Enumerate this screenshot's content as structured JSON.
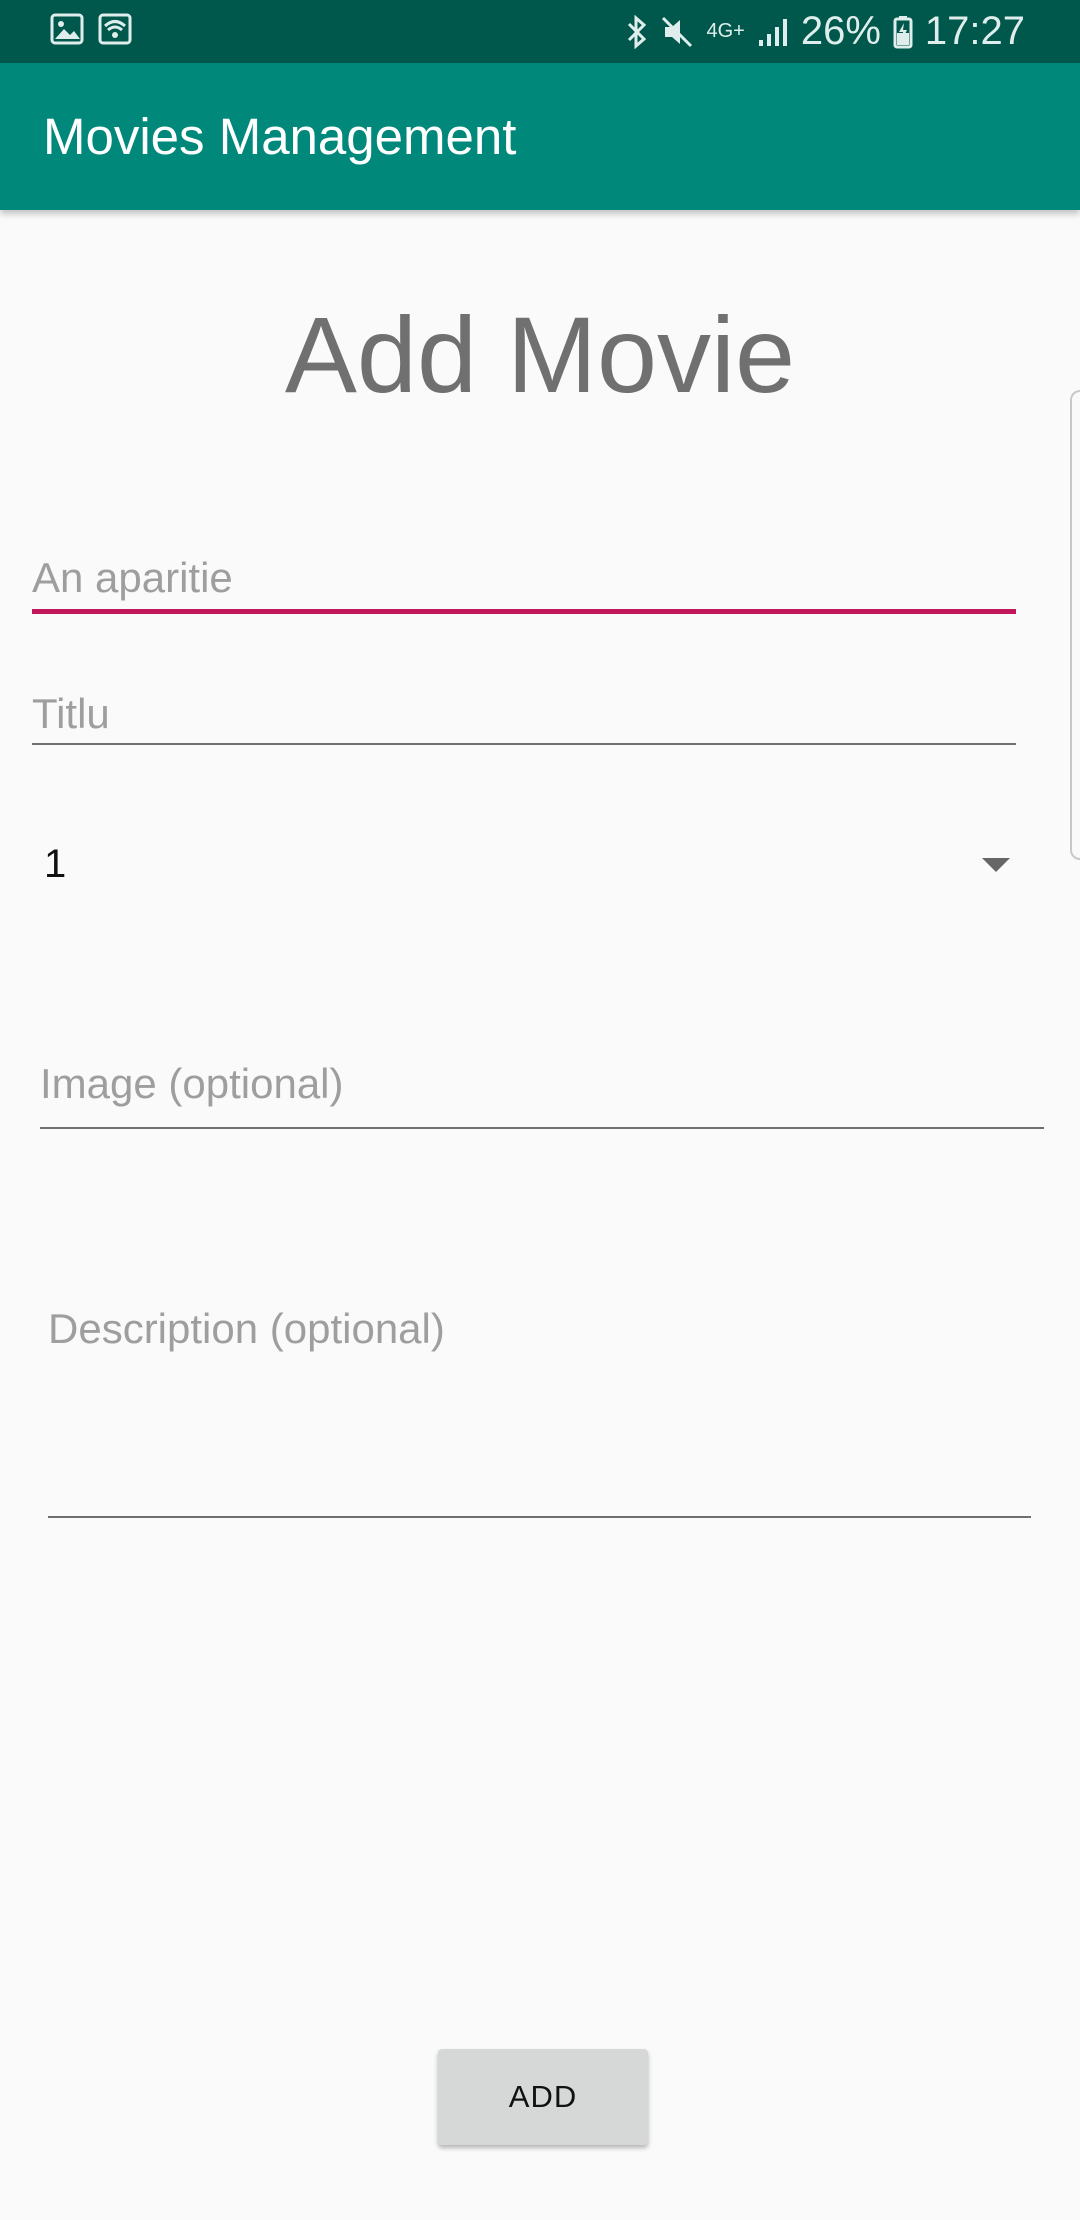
{
  "status_bar": {
    "network_type": "4G+",
    "battery_percent": "26%",
    "time": "17:27",
    "icons": [
      "image-notification-icon",
      "wifi-icon",
      "bluetooth-icon",
      "mute-icon",
      "signal-icon",
      "battery-charging-icon"
    ]
  },
  "app_bar": {
    "title": "Movies Management",
    "color": "#00897b",
    "status_color": "#00574b"
  },
  "form": {
    "heading": "Add Movie",
    "year_placeholder": "An aparitie",
    "title_placeholder": "Titlu",
    "spinner_value": "1",
    "image_placeholder": "Image (optional)",
    "description_placeholder": "Description (optional)",
    "focus_color": "#c2185b",
    "add_button_label": "ADD"
  }
}
